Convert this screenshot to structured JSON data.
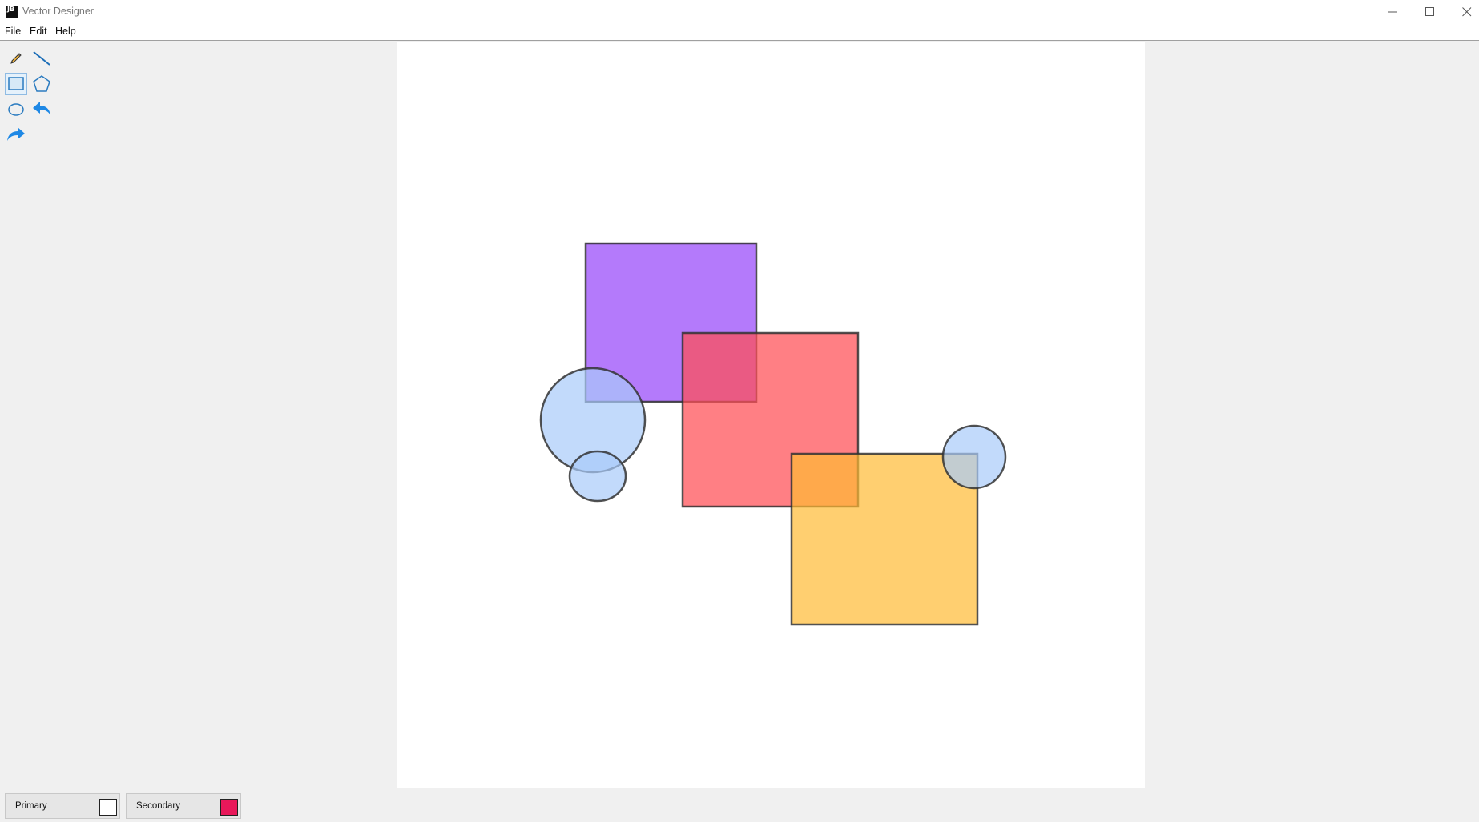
{
  "window": {
    "title": "Vector Designer",
    "icon_text": "JB",
    "controls": [
      "minimize-icon",
      "maximize-icon",
      "close-icon"
    ]
  },
  "menu": {
    "items": [
      {
        "label": "File"
      },
      {
        "label": "Edit"
      },
      {
        "label": "Help"
      }
    ]
  },
  "toolbox": {
    "tools": [
      {
        "name": "pencil",
        "icon": "pencil-icon",
        "selected": false
      },
      {
        "name": "line",
        "icon": "line-icon",
        "selected": false
      },
      {
        "name": "rectangle",
        "icon": "rectangle-icon",
        "selected": true
      },
      {
        "name": "polygon",
        "icon": "pentagon-icon",
        "selected": false
      },
      {
        "name": "ellipse",
        "icon": "ellipse-icon",
        "selected": false
      },
      {
        "name": "undo",
        "icon": "undo-arrow-icon",
        "selected": false
      },
      {
        "name": "redo",
        "icon": "redo-arrow-icon",
        "selected": false
      }
    ]
  },
  "canvas": {
    "background": "#ffffff",
    "shapes": [
      {
        "type": "rectangle",
        "fill": "#9b4dfa",
        "stroke": "#333333"
      },
      {
        "type": "rectangle",
        "fill": "#ff4d55",
        "stroke": "#333333"
      },
      {
        "type": "rectangle",
        "fill": "#ffbb33",
        "stroke": "#333333"
      },
      {
        "type": "ellipse",
        "fill": "#a8cbfa",
        "stroke": "#333333"
      },
      {
        "type": "ellipse",
        "fill": "#a8cbfa",
        "stroke": "#333333"
      },
      {
        "type": "ellipse",
        "fill": "#a8cbfa",
        "stroke": "#333333"
      }
    ]
  },
  "colors": {
    "primary": {
      "label": "Primary",
      "value": "#ffffff"
    },
    "secondary": {
      "label": "Secondary",
      "value": "#e8185a"
    }
  },
  "accent": "#1e88e5"
}
